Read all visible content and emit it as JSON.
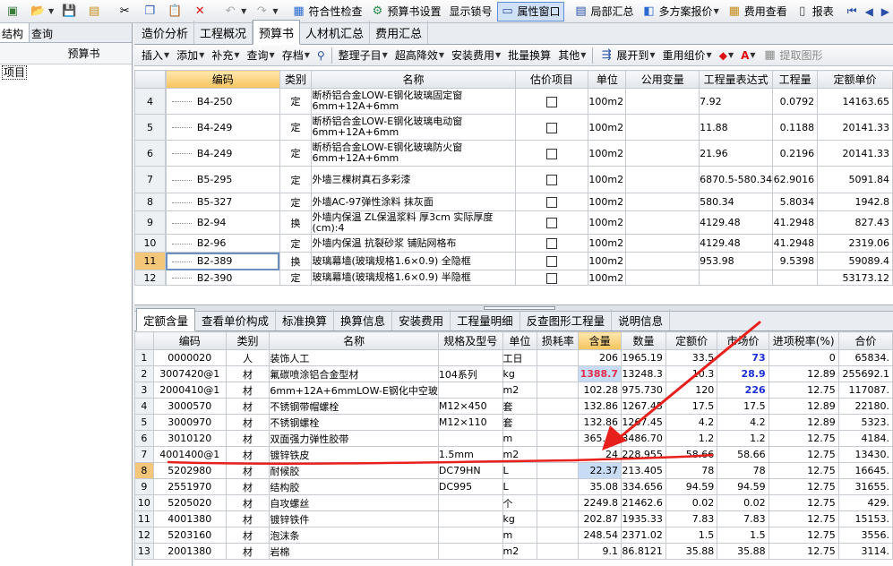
{
  "toolbar": {
    "items": [
      {
        "label": "符合性检查",
        "icon": "check-icon"
      },
      {
        "label": "预算书设置",
        "icon": "settings-icon"
      },
      {
        "label": "显示锁号",
        "icon": ""
      },
      {
        "label": "属性窗口",
        "icon": "window-icon",
        "active": true
      },
      {
        "label": "局部汇总",
        "icon": "summary-icon"
      },
      {
        "label": "多方案报价",
        "icon": "quote-icon",
        "dropdown": true
      },
      {
        "label": "费用查看",
        "icon": "fee-icon"
      },
      {
        "label": "报表",
        "icon": "report-icon"
      }
    ]
  },
  "left": {
    "tabs": [
      "结构",
      "查询"
    ],
    "title": "预算书",
    "tree_item": "项目"
  },
  "main_tabs": [
    "造价分析",
    "工程概况",
    "预算书",
    "人材机汇总",
    "费用汇总"
  ],
  "selected_main_tab": "预算书",
  "toolbar2": [
    "插入",
    "添加",
    "补充",
    "查询",
    "存档",
    "整理子目",
    "超高降效",
    "安装费用",
    "批量换算",
    "其他",
    "展开到",
    "重用组价",
    "提取图形"
  ],
  "upper": {
    "headers": [
      "",
      "",
      "编码",
      "类别",
      "名称",
      "估价项目",
      "单位",
      "公用变量",
      "工程量表达式",
      "工程量",
      "定额单价"
    ],
    "rows": [
      {
        "no": "4",
        "code": "B4-250",
        "type": "定",
        "name": "断桥铝合金LOW-E钢化玻璃固定窗6mm+12A+6mm",
        "unit": "100m2",
        "expr": "7.92",
        "qty": "0.0792",
        "price": "14163.65"
      },
      {
        "no": "5",
        "code": "B4-249",
        "type": "定",
        "name": "断桥铝合金LOW-E钢化玻璃电动窗6mm+12A+6mm",
        "unit": "100m2",
        "expr": "11.88",
        "qty": "0.1188",
        "price": "20141.33"
      },
      {
        "no": "6",
        "code": "B4-249",
        "type": "定",
        "name": "断桥铝合金LOW-E钢化玻璃防火窗6mm+12A+6mm",
        "unit": "100m2",
        "expr": "21.96",
        "qty": "0.2196",
        "price": "20141.33"
      },
      {
        "no": "7",
        "code": "B5-295",
        "type": "定",
        "name": "外墙三棵树真石多彩漆",
        "unit": "100m2",
        "expr": "6870.5-580.34",
        "qty": "62.9016",
        "price": "5091.84"
      },
      {
        "no": "8",
        "code": "B5-327",
        "type": "定",
        "name": "外墙AC-97弹性涂料 抹灰面",
        "unit": "100m2",
        "expr": "580.34",
        "qty": "5.8034",
        "price": "1942.8"
      },
      {
        "no": "9",
        "code": "B2-94",
        "type": "换",
        "name": "外墙内保温 ZL保温浆料 厚3cm  实际厚度(cm):4",
        "unit": "100m2",
        "expr": "4129.48",
        "qty": "41.2948",
        "price": "827.43"
      },
      {
        "no": "10",
        "code": "B2-96",
        "type": "定",
        "name": "外墙内保温 抗裂砂浆 铺贴网格布",
        "unit": "100m2",
        "expr": "4129.48",
        "qty": "41.2948",
        "price": "2319.06"
      },
      {
        "no": "11",
        "code": "B2-389",
        "type": "换",
        "name": "玻璃幕墙(玻璃规格1.6×0.9) 全隐框",
        "unit": "100m2",
        "expr": "953.98",
        "qty": "9.5398",
        "price": "59089.4",
        "selected": true
      },
      {
        "no": "12",
        "code": "B2-390",
        "type": "定",
        "name": "玻璃幕墙(玻璃规格1.6×0.9) 半隐框",
        "unit": "100m2",
        "expr": "",
        "qty": "",
        "price": "53173.12"
      }
    ]
  },
  "lower_tabs": [
    "定额含量",
    "查看单价构成",
    "标准换算",
    "换算信息",
    "安装费用",
    "工程量明细",
    "反查图形工程量",
    "说明信息"
  ],
  "selected_lower_tab": "定额含量",
  "lower": {
    "headers": [
      "",
      "编码",
      "类别",
      "名称",
      "规格及型号",
      "单位",
      "损耗率",
      "含量",
      "数量",
      "定额价",
      "市场价",
      "进项税率(%)",
      "合价"
    ],
    "rows": [
      {
        "no": "1",
        "code": "0000020",
        "type": "人",
        "name": "装饰人工",
        "spec": "",
        "unit": "工日",
        "content": "206",
        "qty": "1965.19",
        "dprice": "33.5",
        "mprice": "73",
        "tax": "0",
        "total": "65834."
      },
      {
        "no": "2",
        "code": "3007420@1",
        "type": "材",
        "name": "氟碳喷涂铝合金型材",
        "spec": "104系列",
        "unit": "kg",
        "content": "1388.7",
        "qty": "13248.3",
        "dprice": "10.3",
        "mprice": "28.9",
        "tax": "12.89",
        "total": "255692.1"
      },
      {
        "no": "3",
        "code": "2000410@1",
        "type": "材",
        "name": "6mm+12A+6mmLOW-E钢化中空玻",
        "spec": "",
        "unit": "m2",
        "content": "102.28",
        "qty": "975.730",
        "dprice": "120",
        "mprice": "226",
        "tax": "12.75",
        "total": "117087."
      },
      {
        "no": "4",
        "code": "3000570",
        "type": "材",
        "name": "不锈钢带帽螺栓",
        "spec": "M12×450",
        "unit": "套",
        "content": "132.86",
        "qty": "1267.45",
        "dprice": "17.5",
        "mprice": "17.5",
        "tax": "12.89",
        "total": "22180."
      },
      {
        "no": "5",
        "code": "3000970",
        "type": "材",
        "name": "不锈钢螺栓",
        "spec": "M12×110",
        "unit": "套",
        "content": "132.86",
        "qty": "1267.45",
        "dprice": "4.2",
        "mprice": "4.2",
        "tax": "12.89",
        "total": "5323."
      },
      {
        "no": "6",
        "code": "3010120",
        "type": "材",
        "name": "双面强力弹性胶带",
        "spec": "",
        "unit": "m",
        "content": "365.48",
        "qty": "3486.70",
        "dprice": "1.2",
        "mprice": "1.2",
        "tax": "12.75",
        "total": "4184."
      },
      {
        "no": "7",
        "code": "4001400@1",
        "type": "材",
        "name": "镀锌铁皮",
        "spec": "1.5mm",
        "unit": "m2",
        "content": "24",
        "qty": "228.955",
        "dprice": "58.66",
        "mprice": "58.66",
        "tax": "12.75",
        "total": "13430."
      },
      {
        "no": "8",
        "code": "5202980",
        "type": "材",
        "name": "耐候胶",
        "spec": "DC79HN",
        "unit": "L",
        "content": "22.37",
        "qty": "213.405",
        "dprice": "78",
        "mprice": "78",
        "tax": "12.75",
        "total": "16645.",
        "selected": true
      },
      {
        "no": "9",
        "code": "2551970",
        "type": "材",
        "name": "结构胶",
        "spec": "DC995",
        "unit": "L",
        "content": "35.08",
        "qty": "334.656",
        "dprice": "94.59",
        "mprice": "94.59",
        "tax": "12.75",
        "total": "31655."
      },
      {
        "no": "10",
        "code": "5205020",
        "type": "材",
        "name": "自攻螺丝",
        "spec": "",
        "unit": "个",
        "content": "2249.8",
        "qty": "21462.6",
        "dprice": "0.02",
        "mprice": "0.02",
        "tax": "12.75",
        "total": "429."
      },
      {
        "no": "11",
        "code": "4001380",
        "type": "材",
        "name": "镀锌铁件",
        "spec": "",
        "unit": "kg",
        "content": "202.87",
        "qty": "1935.33",
        "dprice": "7.83",
        "mprice": "7.83",
        "tax": "12.75",
        "total": "15153."
      },
      {
        "no": "12",
        "code": "5203160",
        "type": "材",
        "name": "泡沫条",
        "spec": "",
        "unit": "m",
        "content": "248.54",
        "qty": "2371.02",
        "dprice": "1.5",
        "mprice": "1.5",
        "tax": "12.75",
        "total": "3556."
      },
      {
        "no": "13",
        "code": "2001380",
        "type": "材",
        "name": "岩棉",
        "spec": "",
        "unit": "m2",
        "content": "9.1",
        "qty": "86.8121",
        "dprice": "35.88",
        "mprice": "35.88",
        "tax": "12.75",
        "total": "3114."
      }
    ]
  },
  "colors": {
    "accent": "#e0304e",
    "annotation": "#e8201c",
    "selection": "#f3c67a",
    "highlight": "#c9dcf5",
    "market_price": "#1b2fd6"
  }
}
